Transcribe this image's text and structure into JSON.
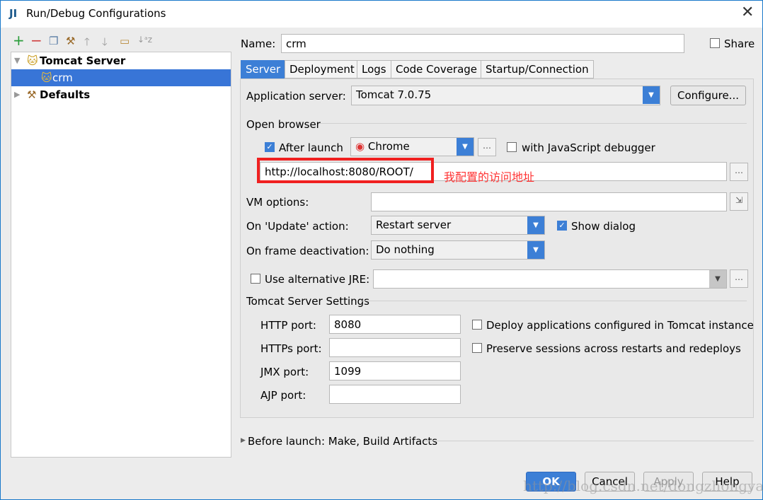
{
  "window": {
    "title": "Run/Debug Configurations",
    "app_icon": "JI"
  },
  "toolbar": {
    "icons": [
      "add-icon",
      "remove-icon",
      "copy-icon",
      "edit-defaults-icon",
      "move-up-icon",
      "move-down-icon",
      "folder-icon",
      "sort-icon"
    ]
  },
  "tree": {
    "items": [
      {
        "label": "Tomcat Server",
        "level": 0,
        "expanded": true
      },
      {
        "label": "crm",
        "level": 1,
        "selected": true
      },
      {
        "label": "Defaults",
        "level": 0,
        "expanded": false
      }
    ]
  },
  "name": {
    "label": "Name:",
    "value": "crm",
    "share_label": "Share",
    "share_checked": false
  },
  "tabs": [
    "Server",
    "Deployment",
    "Logs",
    "Code Coverage",
    "Startup/Connection"
  ],
  "server": {
    "app_server_label": "Application server:",
    "app_server_value": "Tomcat 7.0.75",
    "configure_label": "Configure...",
    "open_browser_label": "Open browser",
    "after_launch_label": "After launch",
    "after_launch_checked": true,
    "browser": "Chrome",
    "js_debugger_label": "with JavaScript debugger",
    "js_debugger_checked": false,
    "url": "http://localhost:8080/ROOT/",
    "annotation": "我配置的访问地址",
    "annotation_color": "#ff3333",
    "vm_label": "VM options:",
    "vm_value": "",
    "update_label": "On 'Update' action:",
    "update_value": "Restart server",
    "show_dialog_label": "Show dialog",
    "show_dialog_checked": true,
    "frame_label": "On frame deactivation:",
    "frame_value": "Do nothing",
    "jre_label": "Use alternative JRE:",
    "jre_checked": false,
    "jre_value": "",
    "tomcat_settings_label": "Tomcat Server Settings",
    "http_label": "HTTP port:",
    "http_value": "8080",
    "https_label": "HTTPs port:",
    "https_value": "",
    "jmx_label": "JMX port:",
    "jmx_value": "1099",
    "ajp_label": "AJP port:",
    "ajp_value": "",
    "deploy_label": "Deploy applications configured in Tomcat instance",
    "deploy_checked": false,
    "preserve_label": "Preserve sessions across restarts and redeploys",
    "preserve_checked": false
  },
  "before_launch": "Before launch: Make, Build Artifacts",
  "buttons": {
    "ok": "OK",
    "cancel": "Cancel",
    "apply": "Apply",
    "help": "Help"
  },
  "watermark": "http://blog.csdn.net/dongzhongyan"
}
